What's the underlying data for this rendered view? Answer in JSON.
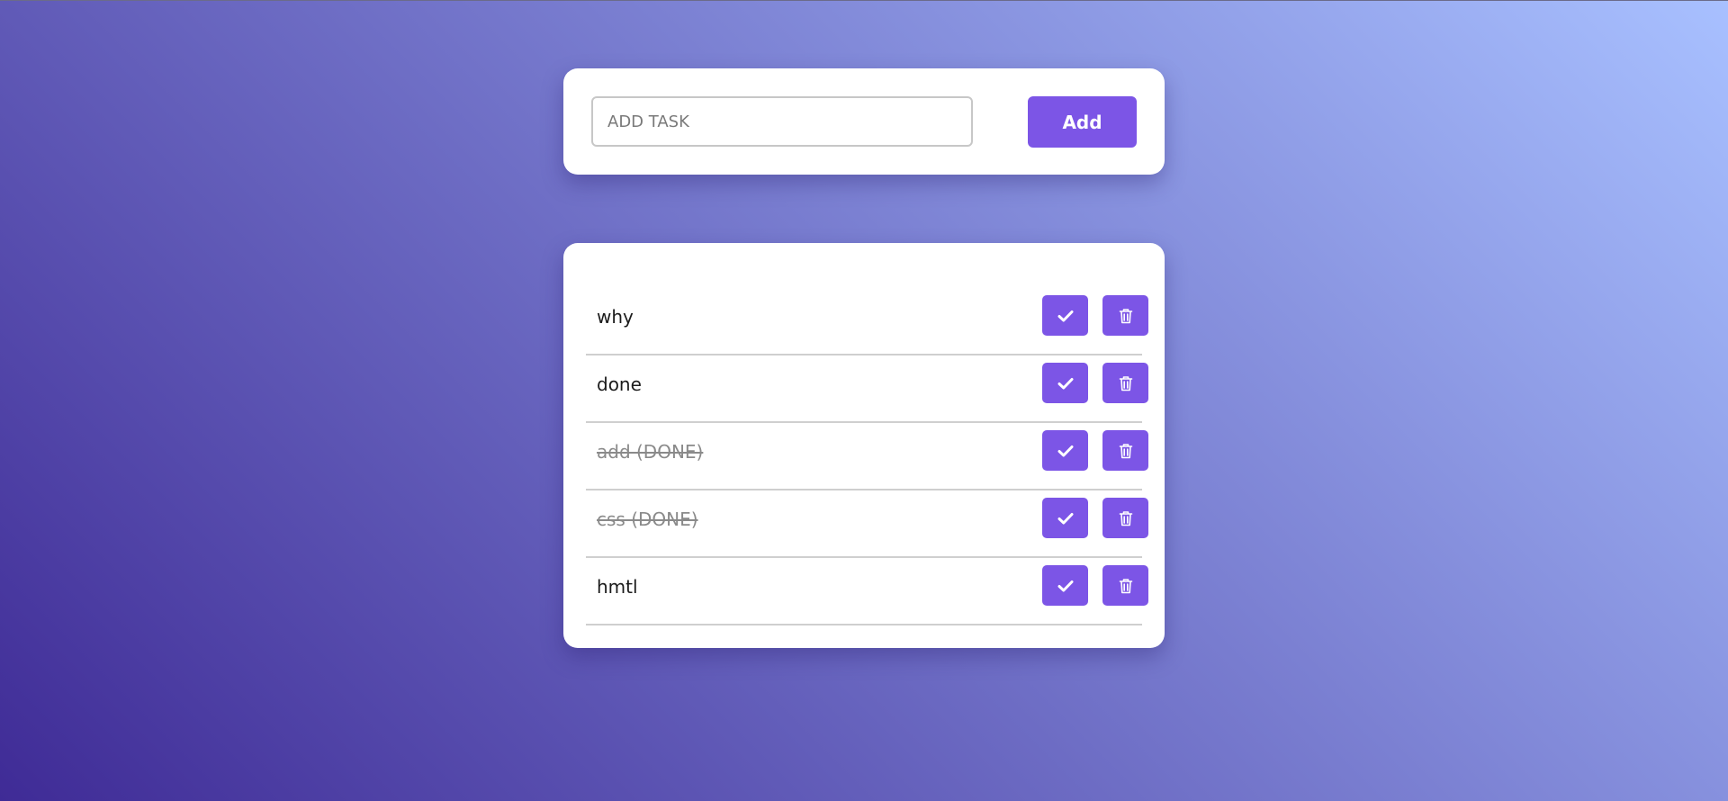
{
  "new_task": {
    "placeholder": "ADD TASK",
    "value": "",
    "add_label": "Add"
  },
  "tasks": [
    {
      "text": "why",
      "done": false
    },
    {
      "text": "done",
      "done": false
    },
    {
      "text": "add (DONE)",
      "done": true
    },
    {
      "text": "css (DONE)",
      "done": true
    },
    {
      "text": "hmtl",
      "done": false
    }
  ],
  "icons": {
    "complete": "check-icon",
    "delete": "trash-icon"
  },
  "colors": {
    "accent": "#7c55e6",
    "gradient_start": "#3f2b96",
    "gradient_end": "#a8c0ff",
    "done_text": "#8a8a8a"
  }
}
